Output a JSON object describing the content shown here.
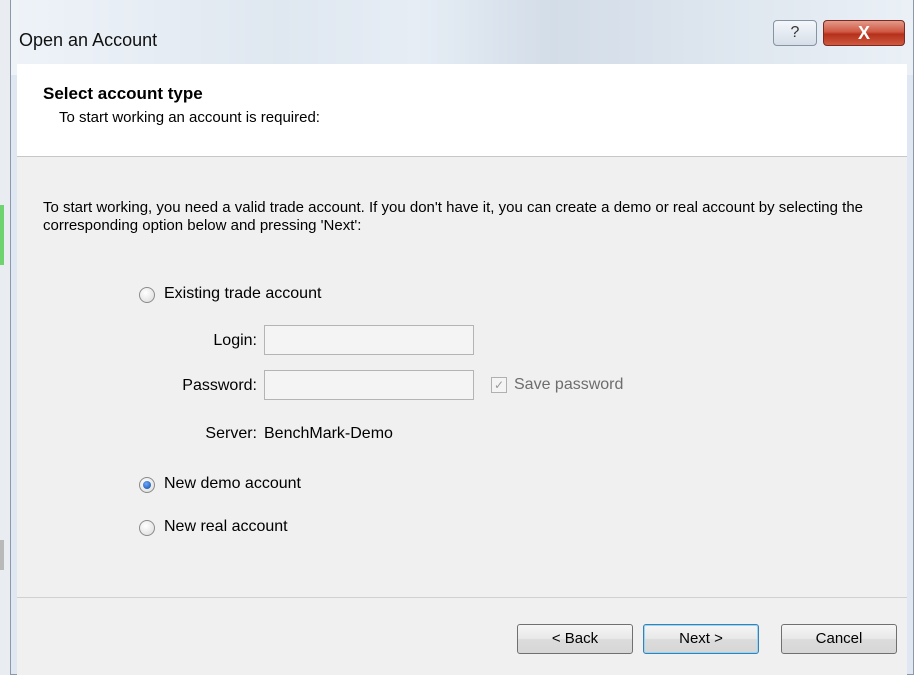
{
  "window": {
    "title": "Open an Account",
    "help_glyph": "?",
    "close_glyph": "X"
  },
  "header": {
    "title": "Select account type",
    "subtitle": "To start working an account is required:"
  },
  "description": "To start working, you need a valid trade account. If you don't have it, you can create a demo or real account by selecting the corresponding option below and pressing 'Next':",
  "options": {
    "existing": {
      "label": "Existing trade account",
      "checked": false
    },
    "demo": {
      "label": "New demo account",
      "checked": true
    },
    "real": {
      "label": "New real account",
      "checked": false
    }
  },
  "fields": {
    "login_label": "Login:",
    "login_value": "",
    "password_label": "Password:",
    "password_value": "",
    "save_password_label": "Save password",
    "save_password_checked": true,
    "server_label": "Server:",
    "server_value": "BenchMark-Demo"
  },
  "buttons": {
    "back": "< Back",
    "next": "Next >",
    "cancel": "Cancel"
  },
  "icons": {
    "check_glyph": "✓"
  }
}
